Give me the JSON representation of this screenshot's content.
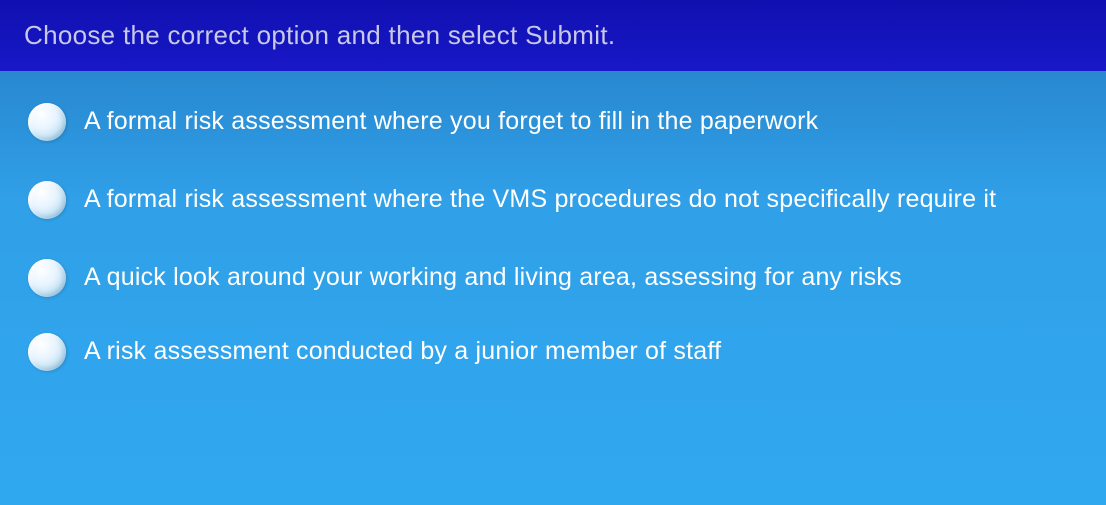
{
  "header": {
    "instruction": "Choose the correct option and then select Submit."
  },
  "options": [
    {
      "label": "A formal risk assessment where you forget to fill in the paperwork"
    },
    {
      "label": "A formal risk assessment where the VMS procedures do not specifically require it"
    },
    {
      "label": "A quick look around your working and living area, assessing for any risks"
    },
    {
      "label": "A risk assessment conducted by a junior member of staff"
    }
  ]
}
